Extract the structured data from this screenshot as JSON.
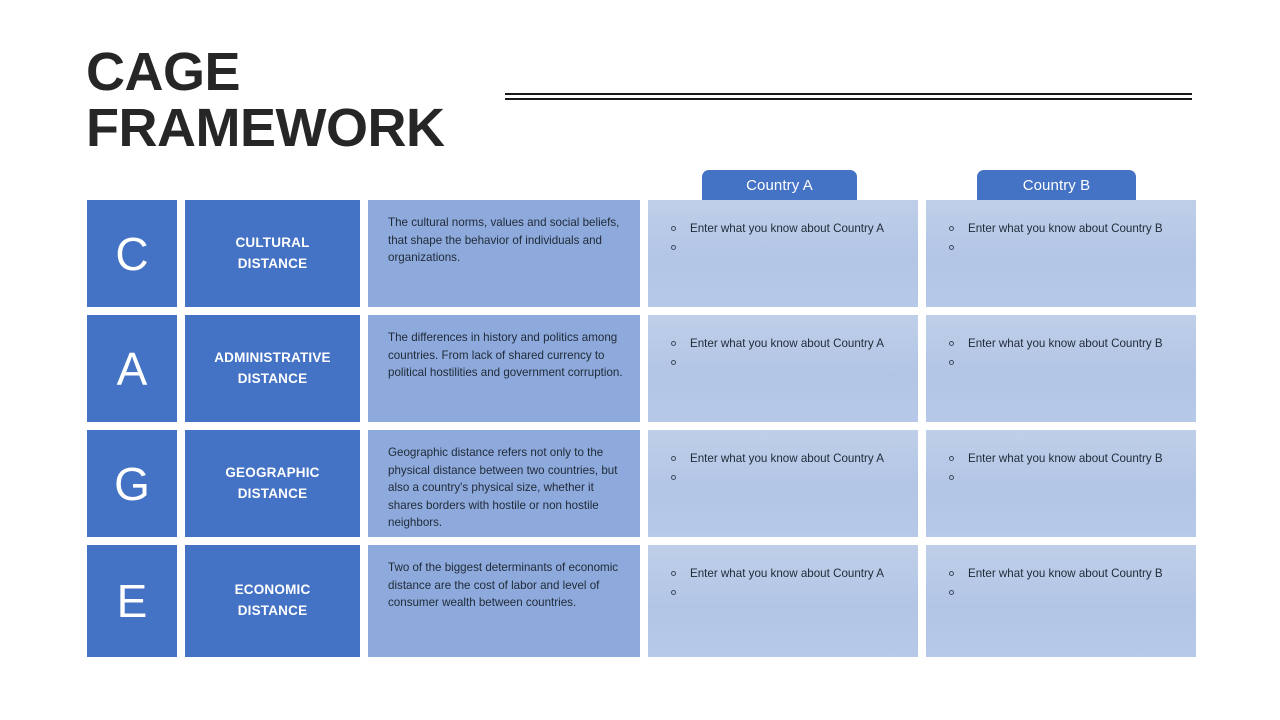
{
  "slide": {
    "title_lines": [
      "CAGE",
      "FRAMEWORK"
    ],
    "accent_color": "#4472c4",
    "description_bg": "#8ea9db",
    "country_bg": "#b4c7e7",
    "title_color": "#262626"
  },
  "columns": {
    "country_a_header": "Country A",
    "country_b_header": "Country B"
  },
  "rows": [
    {
      "letter": "C",
      "label": "CULTURAL\nDISTANCE",
      "label_line1": "CULTURAL",
      "label_line2": "DISTANCE",
      "description": "The cultural norms, values and social beliefs, that shape the behavior of individuals and organizations.",
      "country_a_bullets": [
        "Enter what you know about Country A",
        ""
      ],
      "country_b_bullets": [
        "Enter what you know about Country B",
        ""
      ]
    },
    {
      "letter": "A",
      "label": "ADMINISTRATIVE\nDISTANCE",
      "label_line1": "ADMINISTRATIVE",
      "label_line2": "DISTANCE",
      "description": "The differences in history and politics among countries. From lack of shared currency to political hostilities and government corruption.",
      "country_a_bullets": [
        "Enter what you know about Country A",
        ""
      ],
      "country_b_bullets": [
        "Enter what you know about Country B",
        ""
      ]
    },
    {
      "letter": "G",
      "label": "GEOGRAPHIC\nDISTANCE",
      "label_line1": "GEOGRAPHIC",
      "label_line2": "DISTANCE",
      "description": "Geographic distance refers not only to the physical distance between two countries, but also a country's physical size, whether it shares borders with hostile or non hostile neighbors.",
      "country_a_bullets": [
        "Enter what you know about Country A",
        ""
      ],
      "country_b_bullets": [
        "Enter what you know about Country B",
        ""
      ]
    },
    {
      "letter": "E",
      "label": "ECONOMIC\nDISTANCE",
      "label_line1": "ECONOMIC",
      "label_line2": "DISTANCE",
      "description": "Two of the biggest determinants of economic distance are the cost of labor and level of consumer wealth between countries.",
      "country_a_bullets": [
        "Enter what you know about Country A",
        ""
      ],
      "country_b_bullets": [
        "Enter what you know about Country B",
        ""
      ]
    }
  ]
}
